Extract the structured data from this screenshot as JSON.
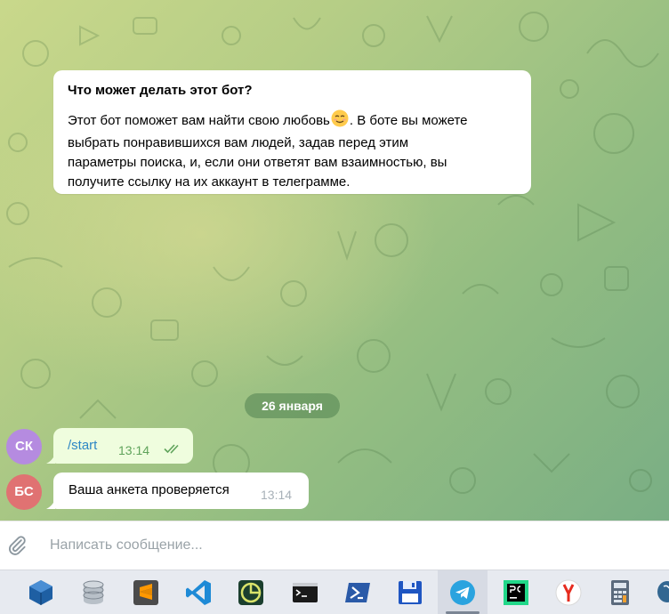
{
  "bot_info": {
    "title": "Что может делать этот бот?",
    "line1_before_emoji": "Этот бот поможет вам найти свою любовь",
    "line1_after_emoji": ". В боте вы можете",
    "line2": "выбрать понравившихся вам людей, задав перед этим",
    "line3": "параметры поиска, и, если они ответят вам взаимностью, вы",
    "line4": "получите ссылку на их аккаунт в телеграмме."
  },
  "date_separator": "26 января",
  "messages": [
    {
      "avatar": "СК",
      "text": "/start",
      "time": "13:14",
      "status": "read"
    },
    {
      "avatar": "БС",
      "text": "Ваша анкета проверяется",
      "time": "13:14"
    }
  ],
  "composer": {
    "placeholder": "Написать сообщение..."
  },
  "taskbar": {
    "icons": [
      "virtualbox-icon",
      "database-icon",
      "sublime-text-icon",
      "vscode-icon",
      "app-icon",
      "terminal-icon",
      "powershell-icon",
      "save-app-icon",
      "telegram-icon",
      "pycharm-icon",
      "yandex-browser-icon",
      "calculator-icon",
      "postgresql-icon"
    ],
    "active": "telegram-icon"
  },
  "colors": {
    "outgoing_bubble": "#effdde",
    "incoming_bubble": "#ffffff",
    "link": "#2e87c5",
    "read_check": "#5fa35b",
    "avatar_ck": "#b58be0",
    "avatar_bc": "#e07272"
  }
}
